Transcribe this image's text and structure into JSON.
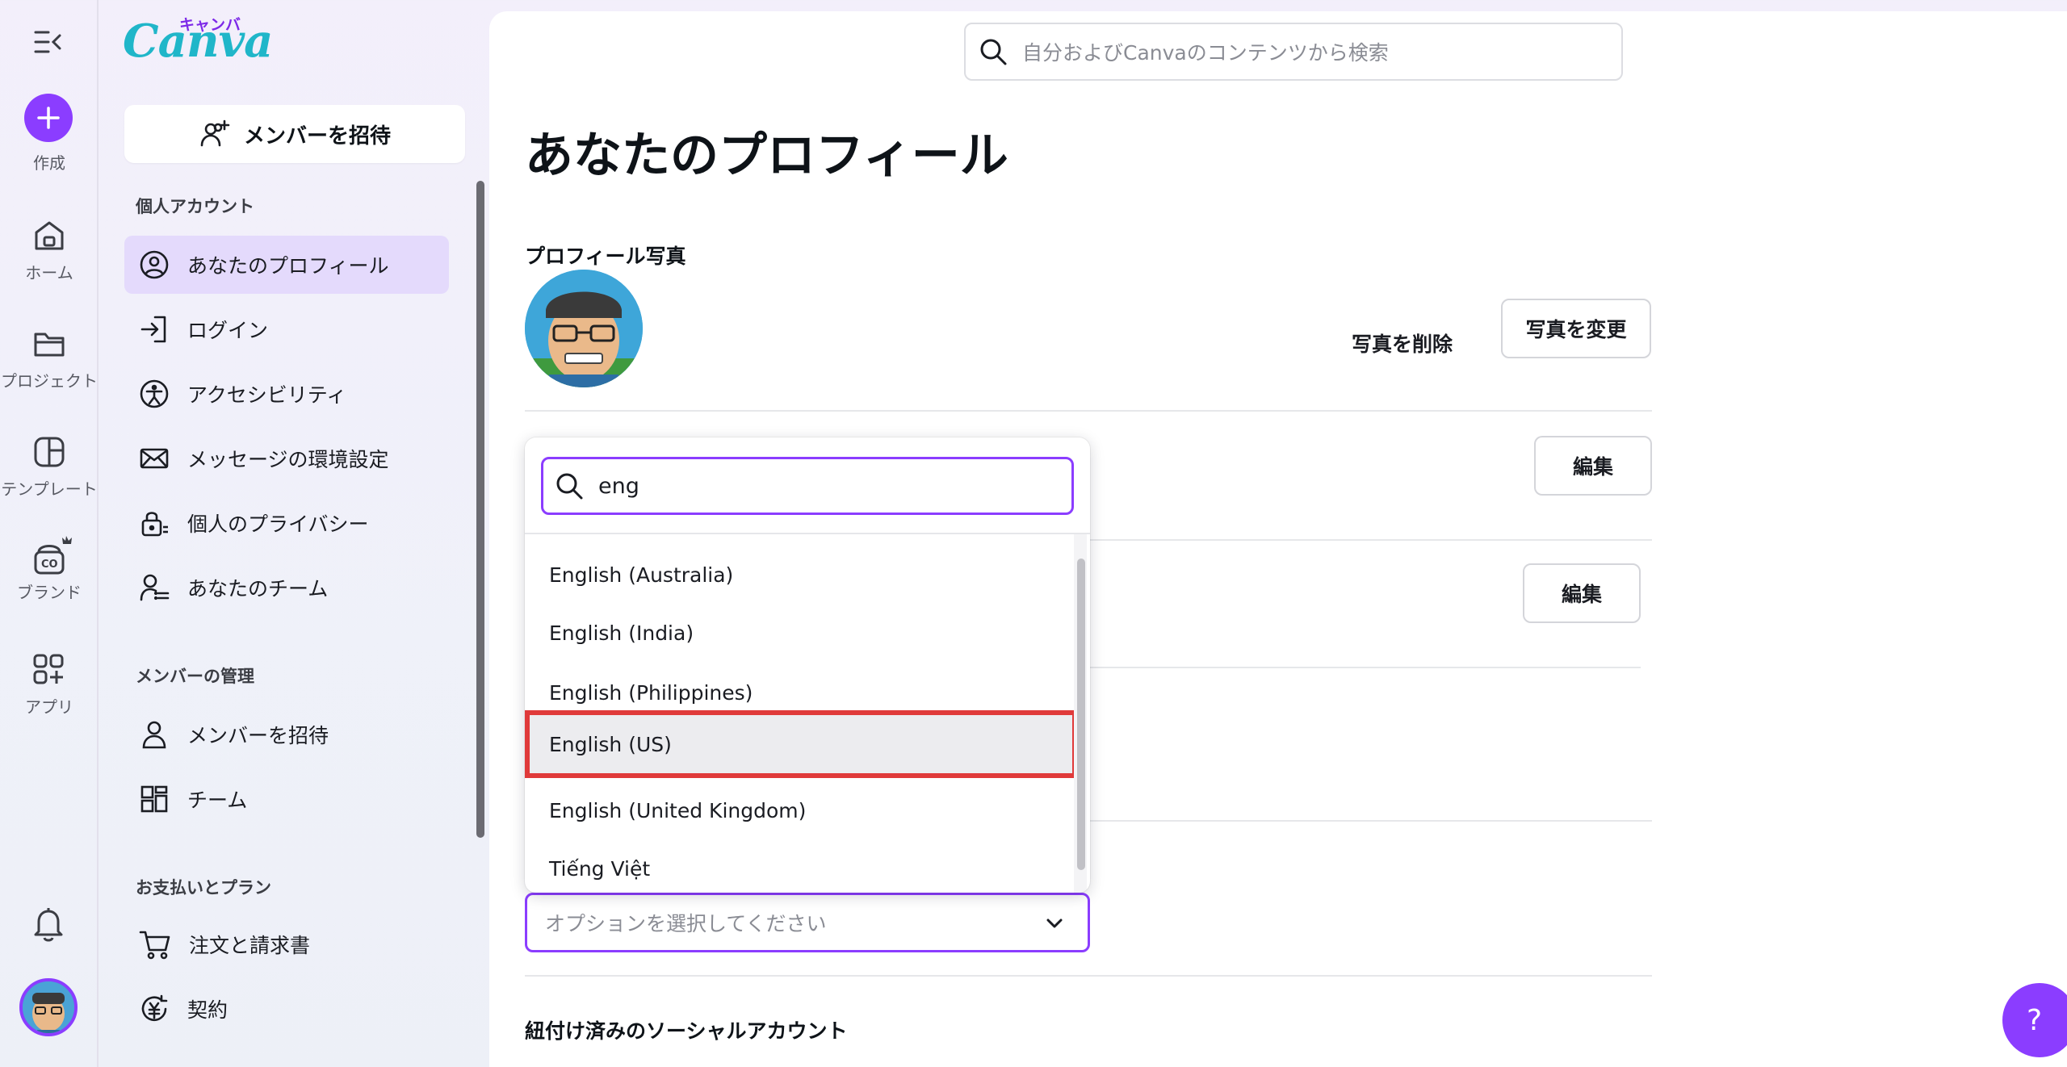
{
  "rail": {
    "create_label": "作成",
    "items": [
      {
        "label": "ホーム",
        "icon": "home-icon"
      },
      {
        "label": "プロジェクト",
        "icon": "folder-icon"
      },
      {
        "label": "テンプレート",
        "icon": "template-icon"
      },
      {
        "label": "ブランド",
        "icon": "brand-icon"
      },
      {
        "label": "アプリ",
        "icon": "apps-icon"
      }
    ]
  },
  "logo": {
    "text": "Canva",
    "kana": "キャンバ"
  },
  "sidebar": {
    "invite_button": "メンバーを招待",
    "sections": [
      {
        "title": "個人アカウント",
        "items": [
          {
            "label": "あなたのプロフィール",
            "icon": "profile-icon",
            "active": true
          },
          {
            "label": "ログイン",
            "icon": "login-icon"
          },
          {
            "label": "アクセシビリティ",
            "icon": "accessibility-icon"
          },
          {
            "label": "メッセージの環境設定",
            "icon": "mail-icon"
          },
          {
            "label": "個人のプライバシー",
            "icon": "privacy-lock-icon"
          },
          {
            "label": "あなたのチーム",
            "icon": "team-icon"
          }
        ]
      },
      {
        "title": "メンバーの管理",
        "items": [
          {
            "label": "メンバーを招待",
            "icon": "person-icon"
          },
          {
            "label": "チーム",
            "icon": "grid-icon"
          }
        ]
      },
      {
        "title": "お支払いとプラン",
        "items": [
          {
            "label": "注文と請求書",
            "icon": "cart-icon"
          },
          {
            "label": "契約",
            "icon": "subscription-icon"
          }
        ]
      }
    ]
  },
  "main": {
    "search_placeholder": "自分およびCanvaのコンテンツから検索",
    "page_title": "あなたのプロフィール",
    "photo_section_label": "プロフィール写真",
    "delete_photo": "写真を削除",
    "change_photo": "写真を変更",
    "edit_label_1": "編集",
    "edit_label_2": "編集",
    "language_select_placeholder": "オプションを選択してください",
    "social_accounts_label": "紐付け済みのソーシャルアカウント",
    "help": "?"
  },
  "dropdown": {
    "search_value": "eng",
    "options": [
      "English (Australia)",
      "English (India)",
      "English (Philippines)",
      "English (US)",
      "English (United Kingdom)",
      "Tiếng Việt"
    ],
    "highlighted": "English (US)"
  },
  "colors": {
    "accent": "#8b3dff",
    "highlight_box": "#e03a3a",
    "logo": "#20b6c9"
  }
}
